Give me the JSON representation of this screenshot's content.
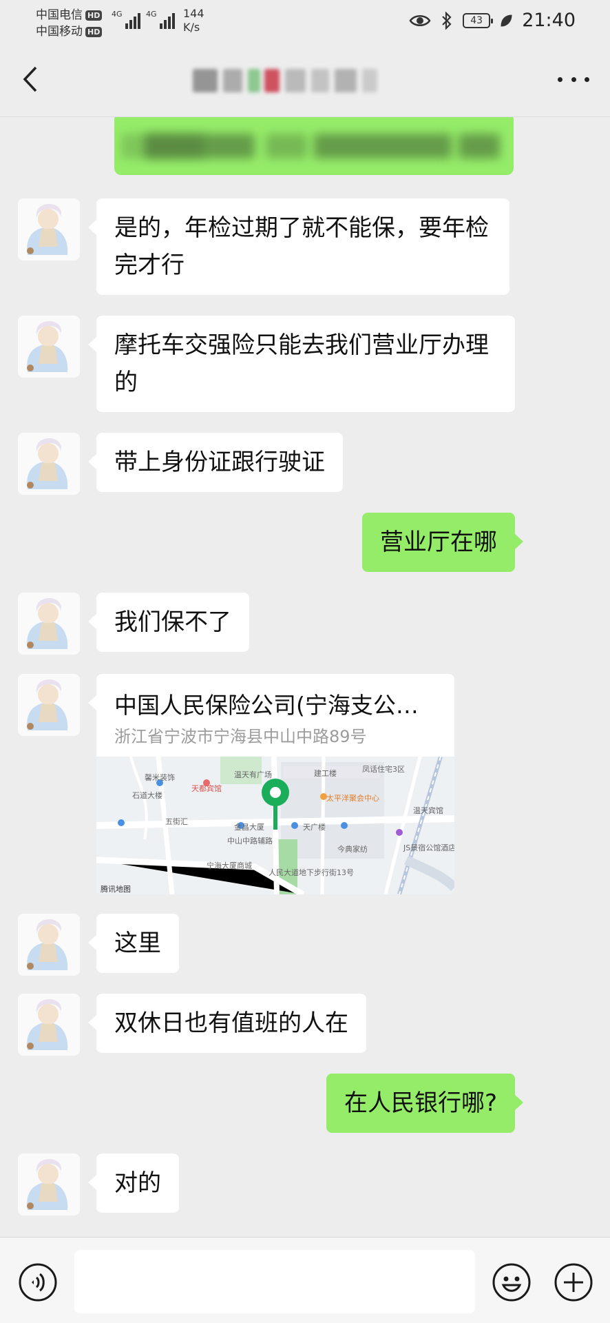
{
  "status_bar": {
    "carrier_1": "中国电信",
    "carrier_2": "中国移动",
    "hd_badge": "HD",
    "network_1": "4G",
    "network_2": "4G",
    "speed_value": "144",
    "speed_unit": "K/s",
    "battery": "43",
    "time": "21:40"
  },
  "header": {
    "title": ""
  },
  "messages": [
    {
      "side": "in",
      "text": "是的，年检过期了就不能保，要年检完才行"
    },
    {
      "side": "in",
      "text": "摩托车交强险只能去我们营业厅办理的"
    },
    {
      "side": "in",
      "text": "带上身份证跟行驶证"
    },
    {
      "side": "out",
      "text": "营业厅在哪"
    },
    {
      "side": "in",
      "text": "我们保不了"
    },
    {
      "side": "in",
      "type": "location",
      "name": "中国人民保险公司(宁海支公…",
      "address": "浙江省宁波市宁海县中山中路89号"
    },
    {
      "side": "in",
      "text": "这里"
    },
    {
      "side": "in",
      "text": "双休日也有值班的人在"
    },
    {
      "side": "out",
      "text": "在人民银行哪?"
    },
    {
      "side": "in",
      "text": "对的"
    }
  ],
  "map_labels": {
    "l1": "馨米装饰",
    "l2": "温天有广场",
    "l3": "建工楼",
    "l4": "凤话住宅3区",
    "l5": "石道大楼",
    "l6": "天都宾馆",
    "l7": "太平洋聚会中心",
    "l8": "温天宾馆",
    "l9": "五街汇",
    "l10": "金昌大厦",
    "l11": "天广楼",
    "l12": "今典家纺",
    "l13": "中山中路辅路",
    "l14": "宁海大厦商城",
    "l15": "人民大道地下步行街13号",
    "l16": "JS景宿公馆酒店",
    "l17": "腾讯地图"
  },
  "input": {
    "placeholder": ""
  },
  "colors": {
    "background": "#ededed",
    "outgoing_bubble": "#95ec69",
    "incoming_bubble": "#ffffff",
    "map_pin": "#1aad5a"
  }
}
